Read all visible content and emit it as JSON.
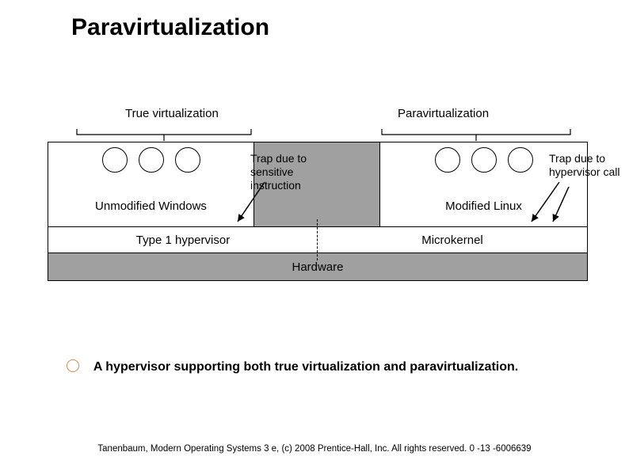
{
  "title": "Paravirtualization",
  "diagram": {
    "top_labels": {
      "true": "True virtualization",
      "para": "Paravirtualization"
    },
    "os": {
      "left": "Unmodified Windows",
      "right": "Modified Linux"
    },
    "hypervisor": {
      "left": "Type 1 hypervisor",
      "right": "Microkernel"
    },
    "hardware": "Hardware",
    "callouts": {
      "trap_sensitive": "Trap due to sensitive instruction",
      "trap_hypervisor": "Trap due to hypervisor call"
    }
  },
  "bullet": "A hypervisor supporting both true virtualization and paravirtualization.",
  "footer": "Tanenbaum, Modern Operating Systems 3 e, (c) 2008 Prentice-Hall, Inc. All rights reserved. 0 -13 -6006639"
}
